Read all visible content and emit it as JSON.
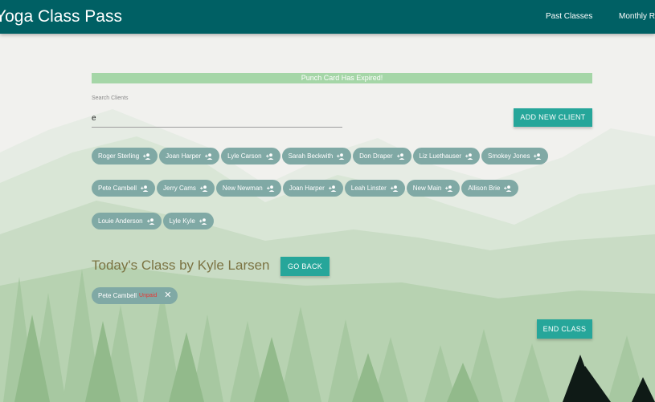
{
  "app": {
    "title": "Yoga Class Pass"
  },
  "nav": {
    "past_classes": "Past Classes",
    "monthly": "Monthly Re"
  },
  "alert": {
    "text": "Punch Card Has Expired!"
  },
  "search": {
    "label": "Search Clients",
    "value": "e"
  },
  "buttons": {
    "add_new_client": "ADD NEW CLIENT",
    "go_back": "GO BACK",
    "end_class": "END CLASS"
  },
  "clients": [
    [
      "Roger Sterling",
      "Joan Harper",
      "Lyle Carson",
      "Sarah Beckwith",
      "Don Draper",
      "Liz Luethauser",
      "Smokey Jones"
    ],
    [
      "Pete Cambell",
      "Jerry Cams",
      "New Newman",
      "Joan Harper",
      "Leah Linster",
      "New Main",
      "Allison Brie"
    ],
    [
      "Louie Anderson",
      "Lyle Kyle"
    ]
  ],
  "todays_class": {
    "title": "Today's Class by Kyle Larsen",
    "attendees": [
      {
        "name": "Pete Cambell",
        "status": "Unpaid"
      }
    ]
  },
  "icons": {
    "chip_icon": "add-person-icon",
    "remove_icon": "close-icon"
  },
  "colors": {
    "navbar": "#006064",
    "accent": "#26a69a",
    "chip": "#80a9a5",
    "alert": "#a5d6a7",
    "title": "#7b7342",
    "unpaid": "#e53935"
  }
}
